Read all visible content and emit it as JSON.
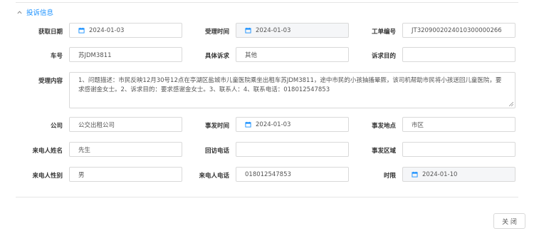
{
  "section": {
    "title": "投诉信息"
  },
  "form": {
    "fetch_date": {
      "label": "获取日期",
      "value": "2024-01-03"
    },
    "accept_time": {
      "label": "受理时间",
      "value": "2024-01-03"
    },
    "ticket_no": {
      "label": "工单编号",
      "value": "JT3209002024010300000266"
    },
    "car_no": {
      "label": "车号",
      "value": "苏JDM3811"
    },
    "complaint": {
      "label": "具体诉求",
      "value": "其他"
    },
    "purpose": {
      "label": "诉求目的",
      "value": ""
    },
    "content": {
      "label": "受理内容",
      "value": "1、问题描述：市民反映12月30号12点在亭湖区盐城市儿童医院乘坐出租车苏JDM3811，途中市民的小孩抽搐晕厥，该司机帮助市民将小孩送回儿童医院，要求感谢金女士。2、诉求目的：要求感谢金女士。3、联系人：4、联系电话：018012547853"
    },
    "company": {
      "label": "公司",
      "value": "公交出租公司"
    },
    "incident_time": {
      "label": "事发时间",
      "value": "2024-01-03"
    },
    "incident_place": {
      "label": "事发地点",
      "value": "市区"
    },
    "caller_name": {
      "label": "来电人姓名",
      "value": "先生"
    },
    "callback_phone": {
      "label": "回访电话",
      "value": ""
    },
    "incident_area": {
      "label": "事发区域",
      "value": ""
    },
    "caller_gender": {
      "label": "来电人性别",
      "value": "男"
    },
    "caller_phone": {
      "label": "来电人电话",
      "value": "018012547853"
    },
    "deadline": {
      "label": "时限",
      "value": "2024-01-10"
    }
  },
  "footer": {
    "close_label": "关 闭"
  },
  "colors": {
    "accent": "#1890ff",
    "border": "#d9d9d9",
    "readonly_bg": "#f5f6f8"
  },
  "icons": {
    "collapse": "chevron-up-icon",
    "date": "calendar-icon"
  }
}
